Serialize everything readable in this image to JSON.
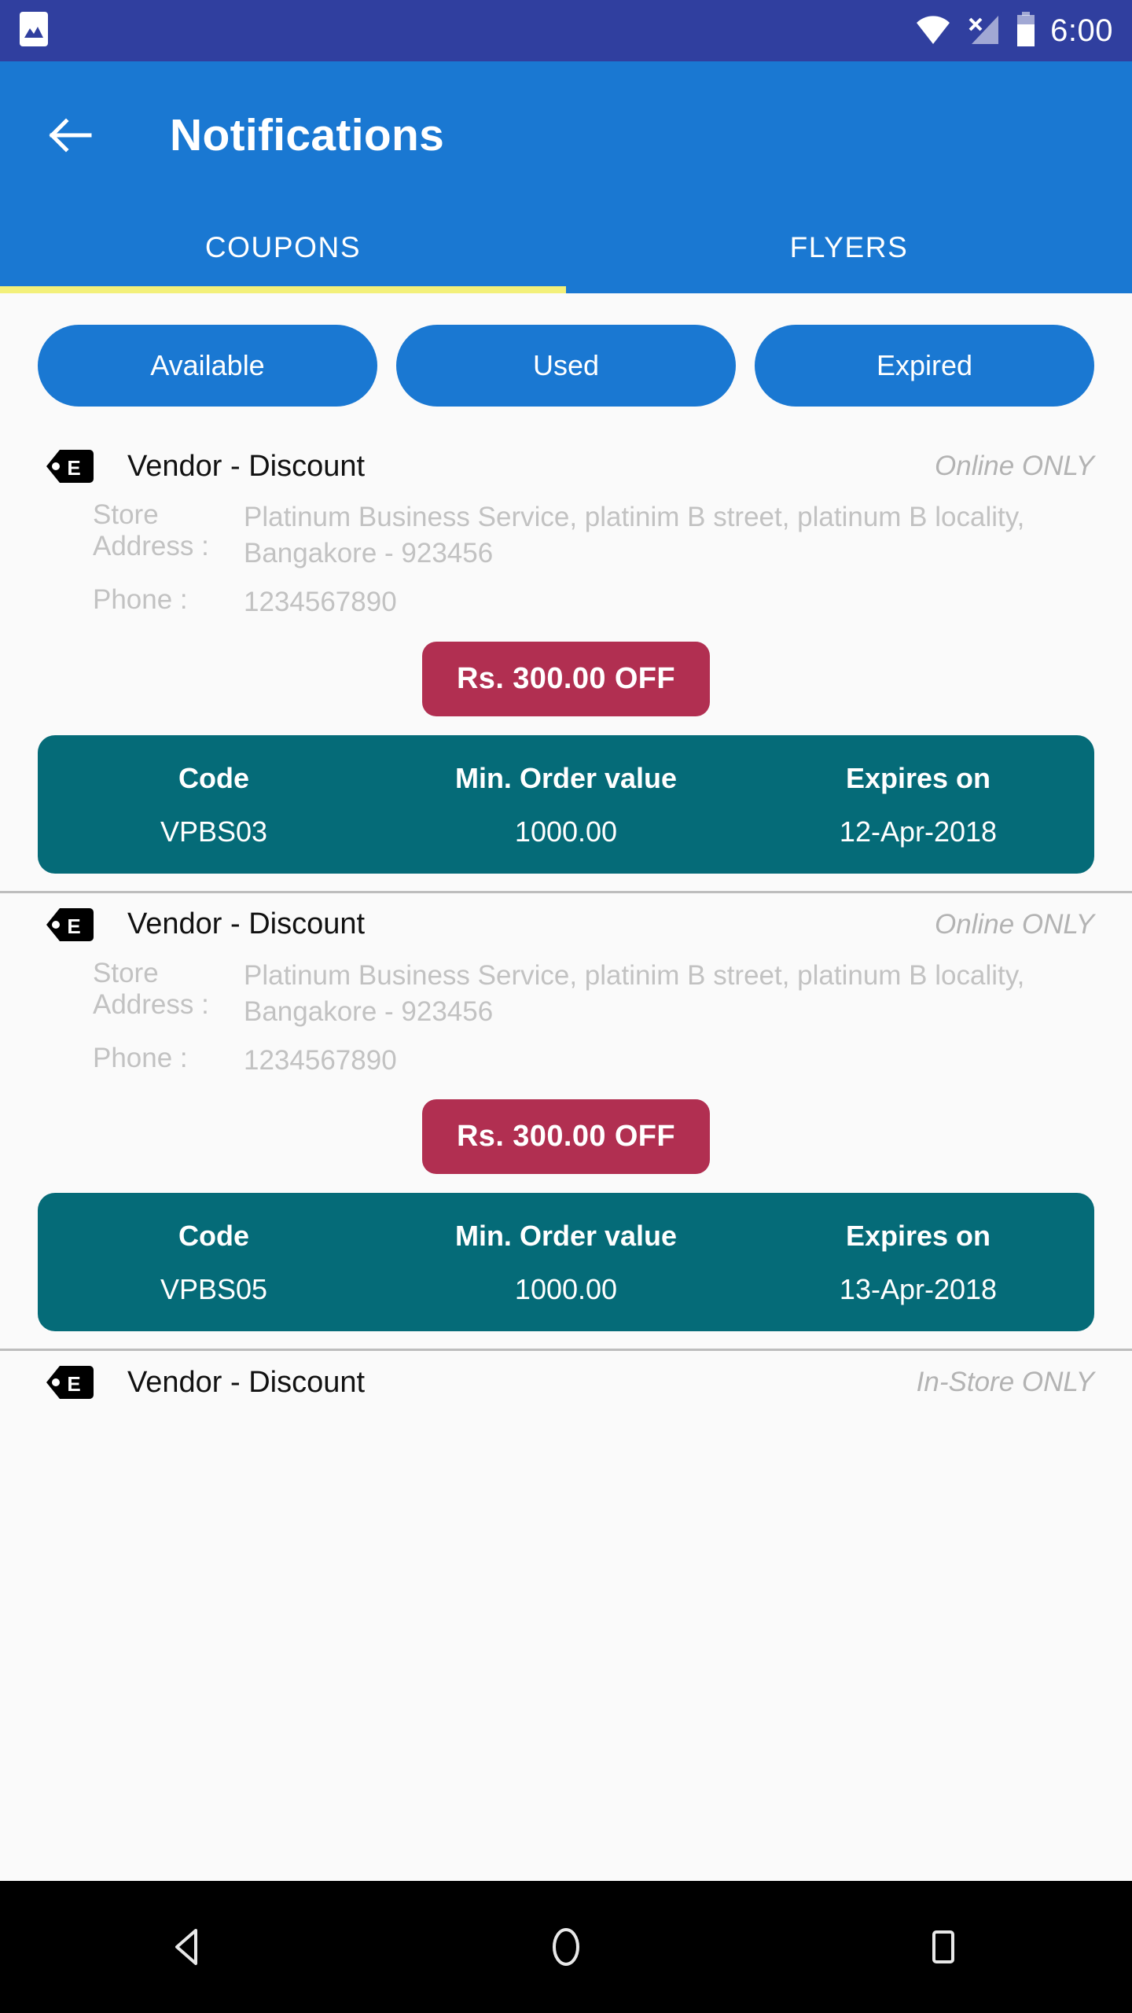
{
  "status_bar": {
    "time": "6:00",
    "background": "#303f9f",
    "icons": [
      "image-icon",
      "wifi-icon",
      "signal-off-icon",
      "battery-icon"
    ]
  },
  "app_bar": {
    "title": "Notifications",
    "back_icon": "back-arrow-icon",
    "background": "#1a78d2",
    "tabs": [
      {
        "label": "COUPONS",
        "active": true
      },
      {
        "label": "FLYERS",
        "active": false
      }
    ],
    "indicator_color": "#f3f07a"
  },
  "filters": {
    "buttons": [
      {
        "label": "Available"
      },
      {
        "label": "Used"
      },
      {
        "label": "Expired"
      }
    ],
    "color": "#1a78d2"
  },
  "labels": {
    "store_address": "Store Address :",
    "phone": "Phone :",
    "code_header": "Code",
    "min_order_header": "Min. Order value",
    "expires_header": "Expires on"
  },
  "coupons": [
    {
      "icon": "coupon-tag-icon",
      "tag_letter": "E",
      "vendor": "Vendor - Discount",
      "availability": "Online ONLY",
      "store_address": "Platinum Business Service, platinim B street, platinum B  locality, Bangakore - 923456",
      "phone": "1234567890",
      "discount": "Rs. 300.00 OFF",
      "code": "VPBS03",
      "min_order_value": "1000.00",
      "expires_on": "12-Apr-2018"
    },
    {
      "icon": "coupon-tag-icon",
      "tag_letter": "E",
      "vendor": "Vendor - Discount",
      "availability": "Online ONLY",
      "store_address": "Platinum Business Service, platinim B street, platinum B  locality, Bangakore - 923456",
      "phone": "1234567890",
      "discount": "Rs. 300.00 OFF",
      "code": "VPBS05",
      "min_order_value": "1000.00",
      "expires_on": "13-Apr-2018"
    },
    {
      "icon": "coupon-tag-icon",
      "tag_letter": "E",
      "vendor": "Vendor - Discount",
      "availability": "In-Store ONLY"
    }
  ],
  "nav_bar": {
    "background": "#000000",
    "buttons": [
      "back-nav-icon",
      "home-nav-icon",
      "recents-nav-icon"
    ]
  },
  "colors": {
    "badge": "#b12f51",
    "code_card": "#056b78",
    "accent": "#1a78d2",
    "tab_indicator": "#f3f07a"
  }
}
